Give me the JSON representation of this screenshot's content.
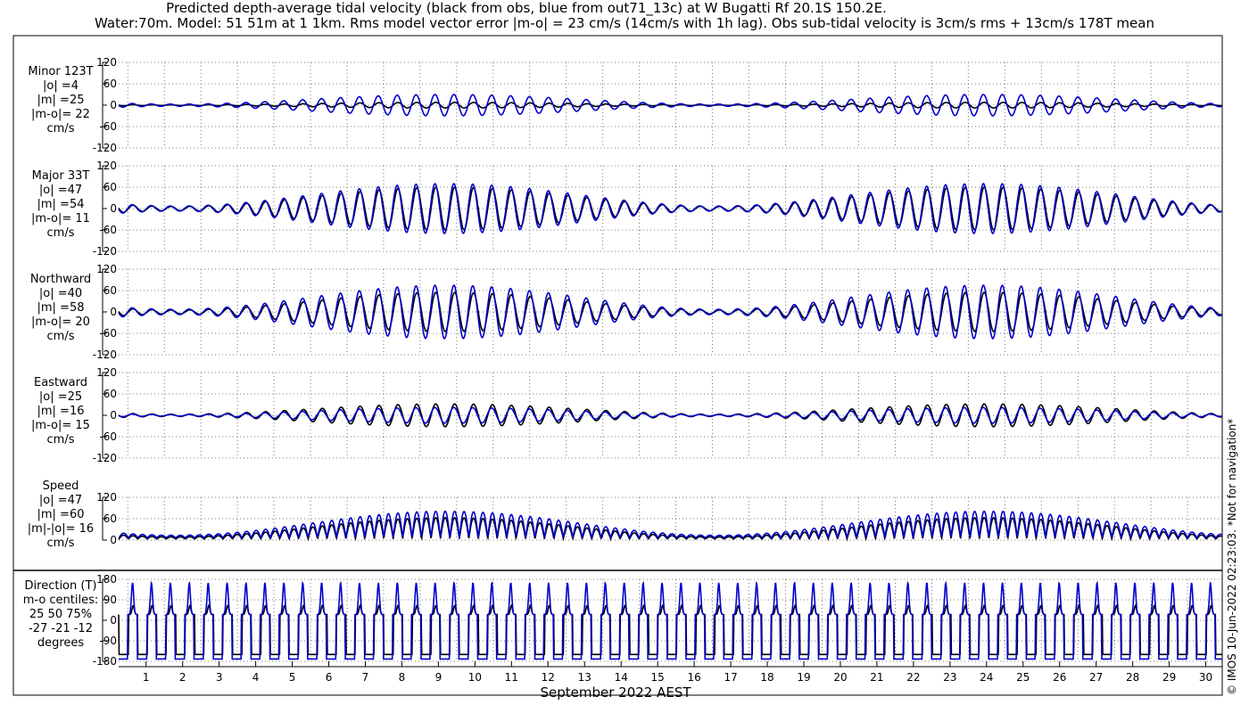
{
  "title_line1": "Predicted depth-average tidal velocity (black from obs, blue from out71_13c) at W Bugatti Rf 20.1S 150.2E.",
  "title_line2": "Water:70m. Model: 51 51m at 1 1km. Rms model vector error |m-o| = 23 cm/s (14cm/s with 1h lag). Obs sub-tidal velocity is 3cm/s rms + 13cm/s 178T mean",
  "copyright": "© IMOS 10-Jun-2022 02:23:03. *Not for navigation*",
  "colors": {
    "obs": "#000000",
    "model": "#0000cc",
    "grid": "#555555"
  },
  "chart_data": {
    "type": "line",
    "xlabel": "September 2022 AEST",
    "x_ticks": [
      "1",
      "2",
      "3",
      "4",
      "5",
      "6",
      "7",
      "8",
      "9",
      "10",
      "11",
      "12",
      "13",
      "14",
      "15",
      "16",
      "17",
      "18",
      "19",
      "20",
      "21",
      "22",
      "23",
      "24",
      "25",
      "26",
      "27",
      "28",
      "29",
      "30"
    ],
    "x_range_days": [
      0.25,
      30.45
    ],
    "grid": true,
    "series_legend": [
      "black from obs",
      "blue from out71_13c"
    ],
    "panels": [
      {
        "key": "minor",
        "label_lines": [
          "Minor 123T",
          "|o| =4",
          "|m| =25",
          "|m-o|= 22",
          "cm/s"
        ],
        "yticks": [
          "120",
          "60",
          "0",
          "-60",
          "-120"
        ],
        "ylim": [
          -120,
          120
        ],
        "obs_amp": 8,
        "model_amp": 30
      },
      {
        "key": "major",
        "label_lines": [
          "Major 33T",
          "|o| =47",
          "|m| =54",
          "|m-o|= 11",
          "cm/s"
        ],
        "yticks": [
          "120",
          "60",
          "0",
          "-60",
          "-120"
        ],
        "ylim": [
          -120,
          120
        ],
        "obs_amp": 60,
        "model_amp": 70
      },
      {
        "key": "north",
        "label_lines": [
          "Northward",
          "|o| =40",
          "|m| =58",
          "|m-o|= 20",
          "cm/s"
        ],
        "yticks": [
          "120",
          "60",
          "0",
          "-60",
          "-120"
        ],
        "ylim": [
          -120,
          120
        ],
        "obs_amp": 55,
        "model_amp": 75
      },
      {
        "key": "east",
        "label_lines": [
          "Eastward",
          "|o| =25",
          "|m| =16",
          "|m-o|= 15",
          "cm/s"
        ],
        "yticks": [
          "120",
          "60",
          "0",
          "-60",
          "-120"
        ],
        "ylim": [
          -120,
          120
        ],
        "obs_amp": 32,
        "model_amp": 22
      },
      {
        "key": "speed",
        "label_lines": [
          "Speed",
          "|o| =47",
          "|m| =60",
          "|m|-|o|= 16",
          "cm/s"
        ],
        "yticks": [
          "120",
          "60",
          "0"
        ],
        "ylim": [
          0,
          120
        ],
        "obs_amp": 60,
        "model_amp": 75
      },
      {
        "key": "direction",
        "label_lines": [
          "Direction (T)",
          "m-o centiles:",
          "25  50  75%",
          "-27 -21 -12",
          "degrees"
        ],
        "yticks": [
          "180",
          "90",
          "0",
          "-90",
          "-180"
        ],
        "ylim": [
          -180,
          180
        ],
        "obs_amp": 0,
        "model_amp": 0
      }
    ]
  }
}
